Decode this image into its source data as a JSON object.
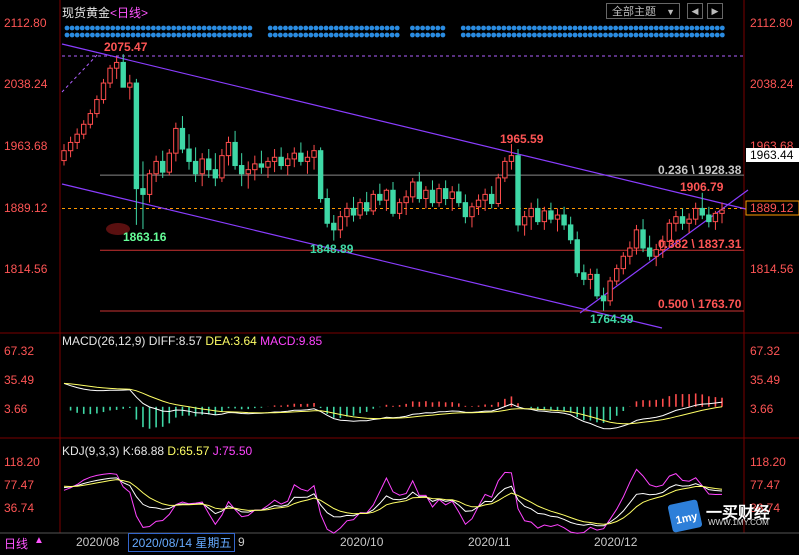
{
  "header": {
    "title": "现货黄金",
    "period": "<日线>",
    "theme_label": "全部主题",
    "theme_arrow": "▼",
    "prev_btn": "◀",
    "next_btn": "▶"
  },
  "bottom_bar": {
    "label": "日线",
    "up_arrow": "▲",
    "hover_date": "2020/08/14 星期五",
    "months": [
      "2020/08",
      "2020/10",
      "2020/11",
      "2020/12"
    ],
    "partial_label": "9"
  },
  "main_axis": {
    "ticks": [
      "2112.80",
      "2038.24",
      "1963.68",
      "1889.12",
      "1814.56"
    ],
    "current_price": "1963.44"
  },
  "annotations": {
    "high": "2075.47",
    "low1": "1863.16",
    "low2": "1848.89",
    "peak2": "1965.59",
    "peak3": "1906.79",
    "low3": "1764.39",
    "fib_236": "0.236 \\ 1928.38",
    "fib_382": "0.382 \\ 1837.31",
    "fib_500": "0.500 \\ 1763.70"
  },
  "macd": {
    "label": "MACD(26,12,9)",
    "diff": "DIFF:8.57",
    "dea": "DEA:3.64",
    "macd": "MACD:9.85",
    "ticks": [
      "67.32",
      "35.49",
      "3.66"
    ]
  },
  "kdj": {
    "label": "KDJ(9,3,3)",
    "k": "K:68.88",
    "d": "D:65.57",
    "j": "J:75.50",
    "ticks": [
      "118.20",
      "77.47",
      "36.74"
    ]
  },
  "logo": {
    "name": "一买财经",
    "url": "WWW.1MY.COM"
  },
  "colors": {
    "up": "#ff4d4d",
    "down": "#3fd8a6",
    "channel": "#8a3dff",
    "dea": "#ffff66",
    "macd_neg": "#3fd8a6",
    "kdj_j": "#ff44ff",
    "kdj_k": "#ffffff",
    "kdj_d": "#ffff66"
  },
  "chart_data": {
    "type": "candlestick",
    "instrument": "现货黄金",
    "period": "日线",
    "ylim": [
      1760,
      2112.8
    ],
    "x_start": "2020/07",
    "x_end": "2020/12",
    "candles": [
      {
        "o": 1946,
        "h": 1966,
        "l": 1940,
        "c": 1958
      },
      {
        "o": 1958,
        "h": 1975,
        "l": 1950,
        "c": 1968
      },
      {
        "o": 1968,
        "h": 1985,
        "l": 1960,
        "c": 1978
      },
      {
        "o": 1978,
        "h": 1995,
        "l": 1972,
        "c": 1990
      },
      {
        "o": 1990,
        "h": 2008,
        "l": 1985,
        "c": 2003
      },
      {
        "o": 2003,
        "h": 2025,
        "l": 1998,
        "c": 2020
      },
      {
        "o": 2020,
        "h": 2045,
        "l": 2015,
        "c": 2040
      },
      {
        "o": 2040,
        "h": 2062,
        "l": 2034,
        "c": 2058
      },
      {
        "o": 2058,
        "h": 2072,
        "l": 2045,
        "c": 2065
      },
      {
        "o": 2065,
        "h": 2075,
        "l": 2050,
        "c": 2035
      },
      {
        "o": 2035,
        "h": 2050,
        "l": 2020,
        "c": 2040
      },
      {
        "o": 2040,
        "h": 2045,
        "l": 1868,
        "c": 1912
      },
      {
        "o": 1912,
        "h": 1945,
        "l": 1863,
        "c": 1905
      },
      {
        "o": 1905,
        "h": 1935,
        "l": 1895,
        "c": 1930
      },
      {
        "o": 1930,
        "h": 1952,
        "l": 1920,
        "c": 1945
      },
      {
        "o": 1945,
        "h": 1958,
        "l": 1925,
        "c": 1932
      },
      {
        "o": 1932,
        "h": 1960,
        "l": 1928,
        "c": 1955
      },
      {
        "o": 1955,
        "h": 1992,
        "l": 1945,
        "c": 1985
      },
      {
        "o": 1985,
        "h": 2000,
        "l": 1955,
        "c": 1960
      },
      {
        "o": 1960,
        "h": 1978,
        "l": 1935,
        "c": 1945
      },
      {
        "o": 1945,
        "h": 1962,
        "l": 1920,
        "c": 1930
      },
      {
        "o": 1930,
        "h": 1955,
        "l": 1915,
        "c": 1948
      },
      {
        "o": 1948,
        "h": 1960,
        "l": 1925,
        "c": 1935
      },
      {
        "o": 1935,
        "h": 1955,
        "l": 1915,
        "c": 1925
      },
      {
        "o": 1925,
        "h": 1960,
        "l": 1920,
        "c": 1952
      },
      {
        "o": 1952,
        "h": 1975,
        "l": 1940,
        "c": 1968
      },
      {
        "o": 1968,
        "h": 1982,
        "l": 1935,
        "c": 1940
      },
      {
        "o": 1940,
        "h": 1955,
        "l": 1915,
        "c": 1930
      },
      {
        "o": 1930,
        "h": 1945,
        "l": 1912,
        "c": 1935
      },
      {
        "o": 1935,
        "h": 1952,
        "l": 1922,
        "c": 1942
      },
      {
        "o": 1942,
        "h": 1958,
        "l": 1930,
        "c": 1938
      },
      {
        "o": 1938,
        "h": 1950,
        "l": 1925,
        "c": 1945
      },
      {
        "o": 1945,
        "h": 1960,
        "l": 1932,
        "c": 1950
      },
      {
        "o": 1950,
        "h": 1962,
        "l": 1935,
        "c": 1940
      },
      {
        "o": 1940,
        "h": 1955,
        "l": 1928,
        "c": 1948
      },
      {
        "o": 1948,
        "h": 1962,
        "l": 1938,
        "c": 1955
      },
      {
        "o": 1955,
        "h": 1968,
        "l": 1940,
        "c": 1945
      },
      {
        "o": 1945,
        "h": 1958,
        "l": 1930,
        "c": 1950
      },
      {
        "o": 1950,
        "h": 1965,
        "l": 1935,
        "c": 1958
      },
      {
        "o": 1958,
        "h": 1962,
        "l": 1895,
        "c": 1900
      },
      {
        "o": 1900,
        "h": 1912,
        "l": 1865,
        "c": 1870
      },
      {
        "o": 1870,
        "h": 1880,
        "l": 1849,
        "c": 1862
      },
      {
        "o": 1862,
        "h": 1885,
        "l": 1852,
        "c": 1878
      },
      {
        "o": 1878,
        "h": 1895,
        "l": 1866,
        "c": 1888
      },
      {
        "o": 1888,
        "h": 1902,
        "l": 1872,
        "c": 1880
      },
      {
        "o": 1880,
        "h": 1900,
        "l": 1875,
        "c": 1895
      },
      {
        "o": 1895,
        "h": 1908,
        "l": 1880,
        "c": 1885
      },
      {
        "o": 1885,
        "h": 1910,
        "l": 1880,
        "c": 1905
      },
      {
        "o": 1905,
        "h": 1918,
        "l": 1892,
        "c": 1898
      },
      {
        "o": 1898,
        "h": 1912,
        "l": 1885,
        "c": 1910
      },
      {
        "o": 1910,
        "h": 1920,
        "l": 1878,
        "c": 1882
      },
      {
        "o": 1882,
        "h": 1900,
        "l": 1875,
        "c": 1895
      },
      {
        "o": 1895,
        "h": 1910,
        "l": 1880,
        "c": 1902
      },
      {
        "o": 1902,
        "h": 1925,
        "l": 1895,
        "c": 1920
      },
      {
        "o": 1920,
        "h": 1932,
        "l": 1895,
        "c": 1900
      },
      {
        "o": 1900,
        "h": 1915,
        "l": 1888,
        "c": 1910
      },
      {
        "o": 1910,
        "h": 1922,
        "l": 1890,
        "c": 1895
      },
      {
        "o": 1895,
        "h": 1918,
        "l": 1890,
        "c": 1912
      },
      {
        "o": 1912,
        "h": 1922,
        "l": 1892,
        "c": 1900
      },
      {
        "o": 1900,
        "h": 1915,
        "l": 1885,
        "c": 1908
      },
      {
        "o": 1908,
        "h": 1918,
        "l": 1890,
        "c": 1895
      },
      {
        "o": 1895,
        "h": 1905,
        "l": 1870,
        "c": 1878
      },
      {
        "o": 1878,
        "h": 1895,
        "l": 1865,
        "c": 1890
      },
      {
        "o": 1890,
        "h": 1905,
        "l": 1880,
        "c": 1898
      },
      {
        "o": 1898,
        "h": 1912,
        "l": 1885,
        "c": 1905
      },
      {
        "o": 1905,
        "h": 1915,
        "l": 1888,
        "c": 1894
      },
      {
        "o": 1894,
        "h": 1930,
        "l": 1890,
        "c": 1925
      },
      {
        "o": 1925,
        "h": 1950,
        "l": 1920,
        "c": 1945
      },
      {
        "o": 1945,
        "h": 1966,
        "l": 1935,
        "c": 1952
      },
      {
        "o": 1952,
        "h": 1960,
        "l": 1860,
        "c": 1868
      },
      {
        "o": 1868,
        "h": 1885,
        "l": 1855,
        "c": 1878
      },
      {
        "o": 1878,
        "h": 1895,
        "l": 1862,
        "c": 1888
      },
      {
        "o": 1888,
        "h": 1900,
        "l": 1868,
        "c": 1872
      },
      {
        "o": 1872,
        "h": 1890,
        "l": 1862,
        "c": 1885
      },
      {
        "o": 1885,
        "h": 1895,
        "l": 1870,
        "c": 1875
      },
      {
        "o": 1875,
        "h": 1888,
        "l": 1860,
        "c": 1880
      },
      {
        "o": 1880,
        "h": 1890,
        "l": 1862,
        "c": 1868
      },
      {
        "o": 1868,
        "h": 1878,
        "l": 1845,
        "c": 1850
      },
      {
        "o": 1850,
        "h": 1860,
        "l": 1805,
        "c": 1810
      },
      {
        "o": 1810,
        "h": 1820,
        "l": 1795,
        "c": 1802
      },
      {
        "o": 1802,
        "h": 1815,
        "l": 1790,
        "c": 1808
      },
      {
        "o": 1808,
        "h": 1815,
        "l": 1778,
        "c": 1782
      },
      {
        "o": 1782,
        "h": 1792,
        "l": 1764,
        "c": 1776
      },
      {
        "o": 1776,
        "h": 1805,
        "l": 1770,
        "c": 1800
      },
      {
        "o": 1800,
        "h": 1820,
        "l": 1795,
        "c": 1815
      },
      {
        "o": 1815,
        "h": 1835,
        "l": 1808,
        "c": 1830
      },
      {
        "o": 1830,
        "h": 1848,
        "l": 1820,
        "c": 1840
      },
      {
        "o": 1840,
        "h": 1868,
        "l": 1832,
        "c": 1862
      },
      {
        "o": 1862,
        "h": 1875,
        "l": 1835,
        "c": 1840
      },
      {
        "o": 1840,
        "h": 1855,
        "l": 1825,
        "c": 1830
      },
      {
        "o": 1830,
        "h": 1845,
        "l": 1818,
        "c": 1838
      },
      {
        "o": 1838,
        "h": 1855,
        "l": 1828,
        "c": 1848
      },
      {
        "o": 1848,
        "h": 1875,
        "l": 1840,
        "c": 1870
      },
      {
        "o": 1870,
        "h": 1885,
        "l": 1860,
        "c": 1878
      },
      {
        "o": 1878,
        "h": 1888,
        "l": 1862,
        "c": 1870
      },
      {
        "o": 1870,
        "h": 1882,
        "l": 1858,
        "c": 1875
      },
      {
        "o": 1875,
        "h": 1895,
        "l": 1868,
        "c": 1888
      },
      {
        "o": 1888,
        "h": 1907,
        "l": 1875,
        "c": 1880
      },
      {
        "o": 1880,
        "h": 1890,
        "l": 1865,
        "c": 1872
      },
      {
        "o": 1872,
        "h": 1885,
        "l": 1862,
        "c": 1882
      },
      {
        "o": 1882,
        "h": 1895,
        "l": 1870,
        "c": 1886
      }
    ],
    "channel_upper": [
      {
        "start": 2075.47,
        "end": 1880
      }
    ],
    "fibonacci": [
      {
        "ratio": "0.236",
        "value": 1928.38
      },
      {
        "ratio": "0.382",
        "value": 1837.31
      },
      {
        "ratio": "0.500",
        "value": 1763.7
      }
    ],
    "macd": {
      "DIFF": 8.57,
      "DEA": 3.64,
      "MACD": 9.85,
      "ylim": [
        -40,
        75
      ]
    },
    "kdj": {
      "K": 68.88,
      "D": 65.57,
      "J": 75.5,
      "ylim": [
        0,
        125
      ]
    }
  }
}
